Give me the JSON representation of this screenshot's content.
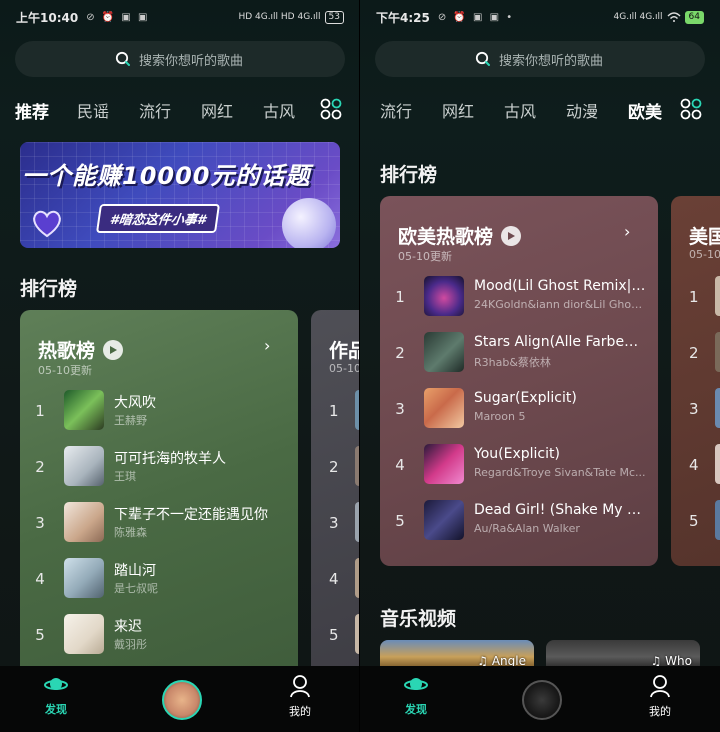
{
  "left": {
    "status": {
      "time": "上午10:40",
      "left_icons": "⊘ ⏰ ▣ ▣",
      "right_text": "HD 4G.ıll HD 4G.ıll",
      "battery": "53"
    },
    "search": {
      "placeholder": "搜索你想听的歌曲"
    },
    "tabs": [
      "推荐",
      "民谣",
      "流行",
      "网红",
      "古风"
    ],
    "active_tab": "推荐",
    "banner": {
      "title": "一个能赚10000元的话题",
      "tag": "#暗恋这件小事#"
    },
    "section_title": "排行榜",
    "chart": {
      "name": "热歌榜",
      "updated": "05-10更新",
      "chevron": "›",
      "rows": [
        {
          "rank": "1",
          "song": "大风吹",
          "artist": "王赫野"
        },
        {
          "rank": "2",
          "song": "可可托海的牧羊人",
          "artist": "王琪"
        },
        {
          "rank": "3",
          "song": "下辈子不一定还能遇见你",
          "artist": "陈雅森"
        },
        {
          "rank": "4",
          "song": "踏山河",
          "artist": "是七叔呢"
        },
        {
          "rank": "5",
          "song": "来迟",
          "artist": "戴羽彤"
        }
      ]
    },
    "peek": {
      "name": "作品",
      "sub": "05-10",
      "ranks": [
        "1",
        "2",
        "3",
        "4",
        "5"
      ]
    },
    "nav": {
      "discover": "发现",
      "mine": "我的"
    }
  },
  "right": {
    "status": {
      "time": "下午4:25",
      "left_icons": "⊘ ⏰ ▣ ▣ •",
      "right_text": "4G.ıll 4G.ıll",
      "battery": "64"
    },
    "search": {
      "placeholder": "搜索你想听的歌曲"
    },
    "tabs": [
      "流行",
      "网红",
      "古风",
      "动漫",
      "欧美"
    ],
    "active_tab": "欧美",
    "section_title": "排行榜",
    "chart": {
      "name": "欧美热歌榜",
      "updated": "05-10更新",
      "chevron": "›",
      "rows": [
        {
          "rank": "1",
          "song": "Mood(Lil Ghost Remix|E...",
          "artist": "24KGoldn&iann dior&Lil Ghost..."
        },
        {
          "rank": "2",
          "song": "Stars Align(Alle Farben ...",
          "artist": "R3hab&蔡依林"
        },
        {
          "rank": "3",
          "song": "Sugar(Explicit)",
          "artist": "Maroon 5"
        },
        {
          "rank": "4",
          "song": "You(Explicit)",
          "artist": "Regard&Troye Sivan&Tate Mc..."
        },
        {
          "rank": "5",
          "song": "Dead Girl! (Shake My H...",
          "artist": "Au/Ra&Alan Walker"
        }
      ]
    },
    "peek": {
      "name": "美国",
      "sub": "05-10",
      "ranks": [
        "1",
        "2",
        "3",
        "4",
        "5"
      ]
    },
    "video_section_title": "音乐视频",
    "videos": [
      {
        "label": "♫ Angle"
      },
      {
        "label": "♫ Who"
      }
    ],
    "nav": {
      "discover": "发现",
      "mine": "我的"
    }
  },
  "colors": {
    "accent": "#2ad6b4",
    "left_card": "#4a6a44",
    "right_card": "#6e4a4f",
    "background": "#0e1a19"
  }
}
